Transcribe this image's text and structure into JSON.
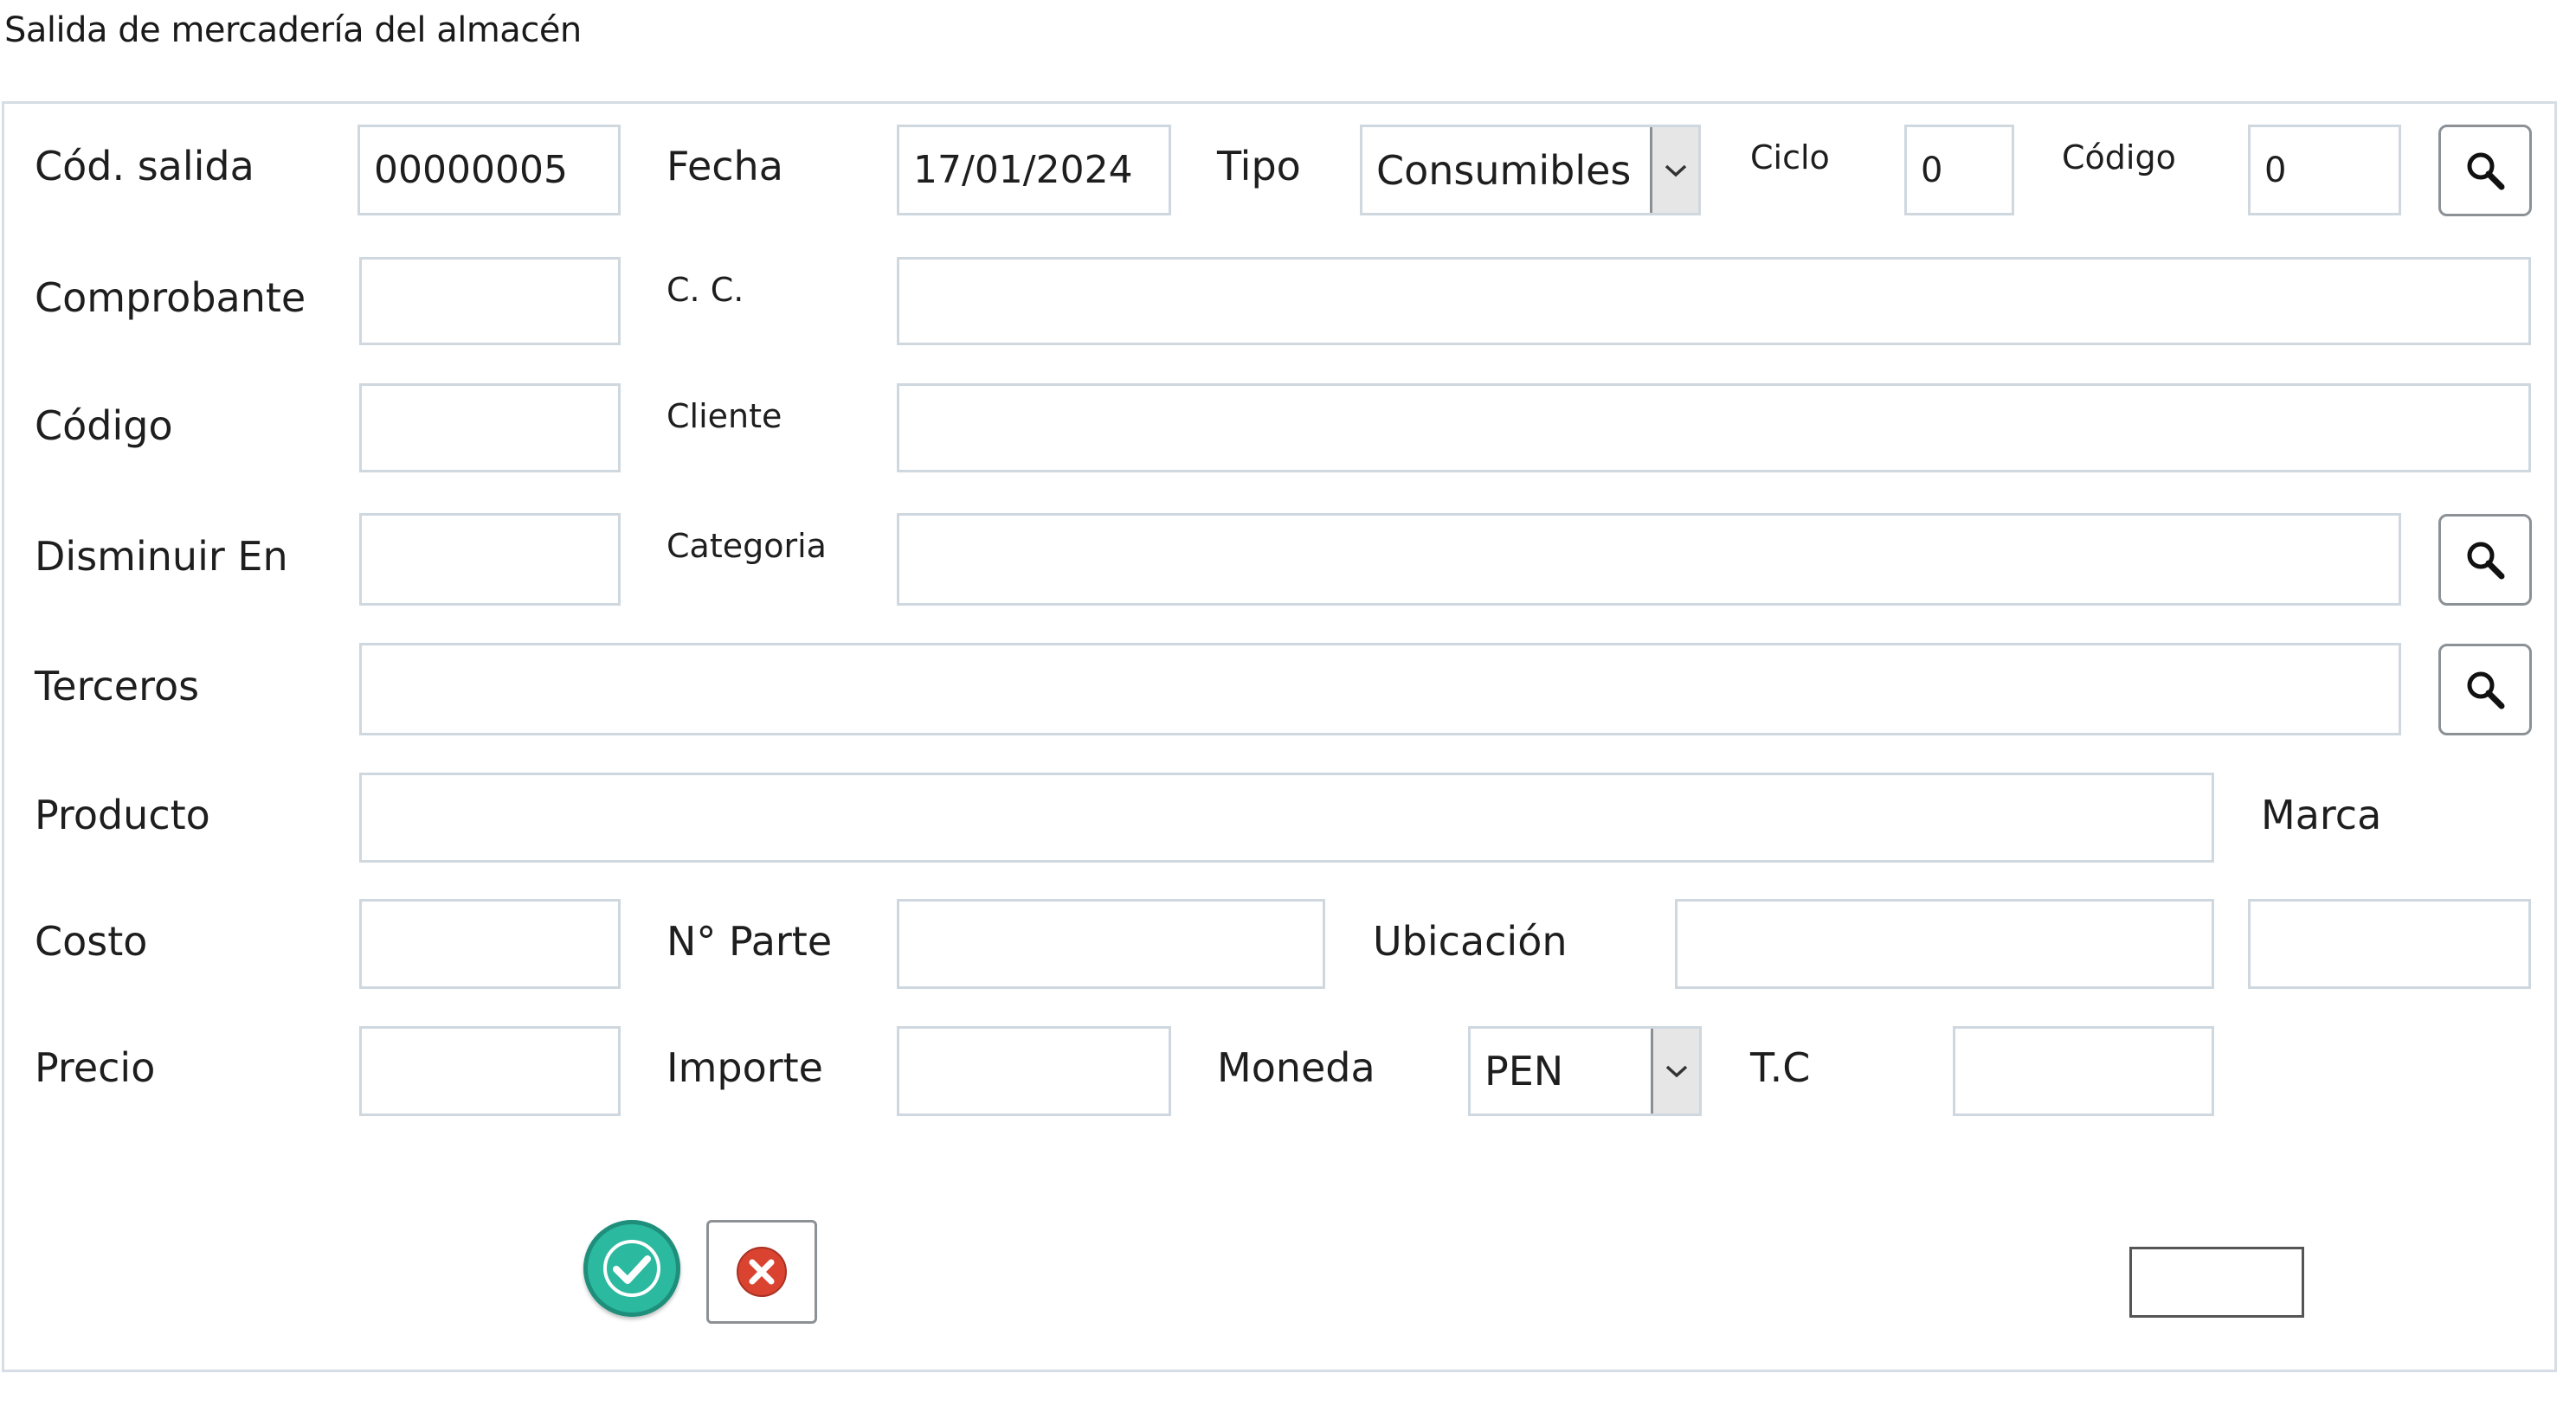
{
  "window": {
    "title": "Salida de mercadería del almacén"
  },
  "form": {
    "cod_salida": {
      "label": "Cód. salida",
      "value": "00000005"
    },
    "fecha": {
      "label": "Fecha",
      "value": "17/01/2024"
    },
    "tipo": {
      "label": "Tipo",
      "value": "Consumibles"
    },
    "ciclo": {
      "label": "Ciclo",
      "value": "0"
    },
    "codigo_top": {
      "label": "Código",
      "value": "0"
    },
    "comprobante": {
      "label": "Comprobante",
      "value": ""
    },
    "cc": {
      "label": "C. C.",
      "value": ""
    },
    "codigo": {
      "label": "Código",
      "value": ""
    },
    "cliente": {
      "label": "Cliente",
      "value": ""
    },
    "disminuir_en": {
      "label": "Disminuir En",
      "value": ""
    },
    "categoria": {
      "label": "Categoria",
      "value": ""
    },
    "terceros": {
      "label": "Terceros",
      "value": ""
    },
    "producto": {
      "label": "Producto",
      "value": ""
    },
    "marca": {
      "label": "Marca",
      "value": ""
    },
    "costo": {
      "label": "Costo",
      "value": ""
    },
    "n_parte": {
      "label": "N° Parte",
      "value": ""
    },
    "ubicacion": {
      "label": "Ubicación",
      "value": ""
    },
    "precio": {
      "label": "Precio",
      "value": ""
    },
    "importe": {
      "label": "Importe",
      "value": ""
    },
    "moneda": {
      "label": "Moneda",
      "value": "PEN"
    },
    "tc": {
      "label": "T.C",
      "value": ""
    }
  },
  "icons": {
    "search": "search-icon",
    "accept": "check-icon",
    "cancel": "close-icon",
    "dropdown": "chevron-down-icon"
  },
  "colors": {
    "accept_green": "#2bb99f",
    "cancel_red": "#d9432f",
    "border": "#cfd7df"
  }
}
